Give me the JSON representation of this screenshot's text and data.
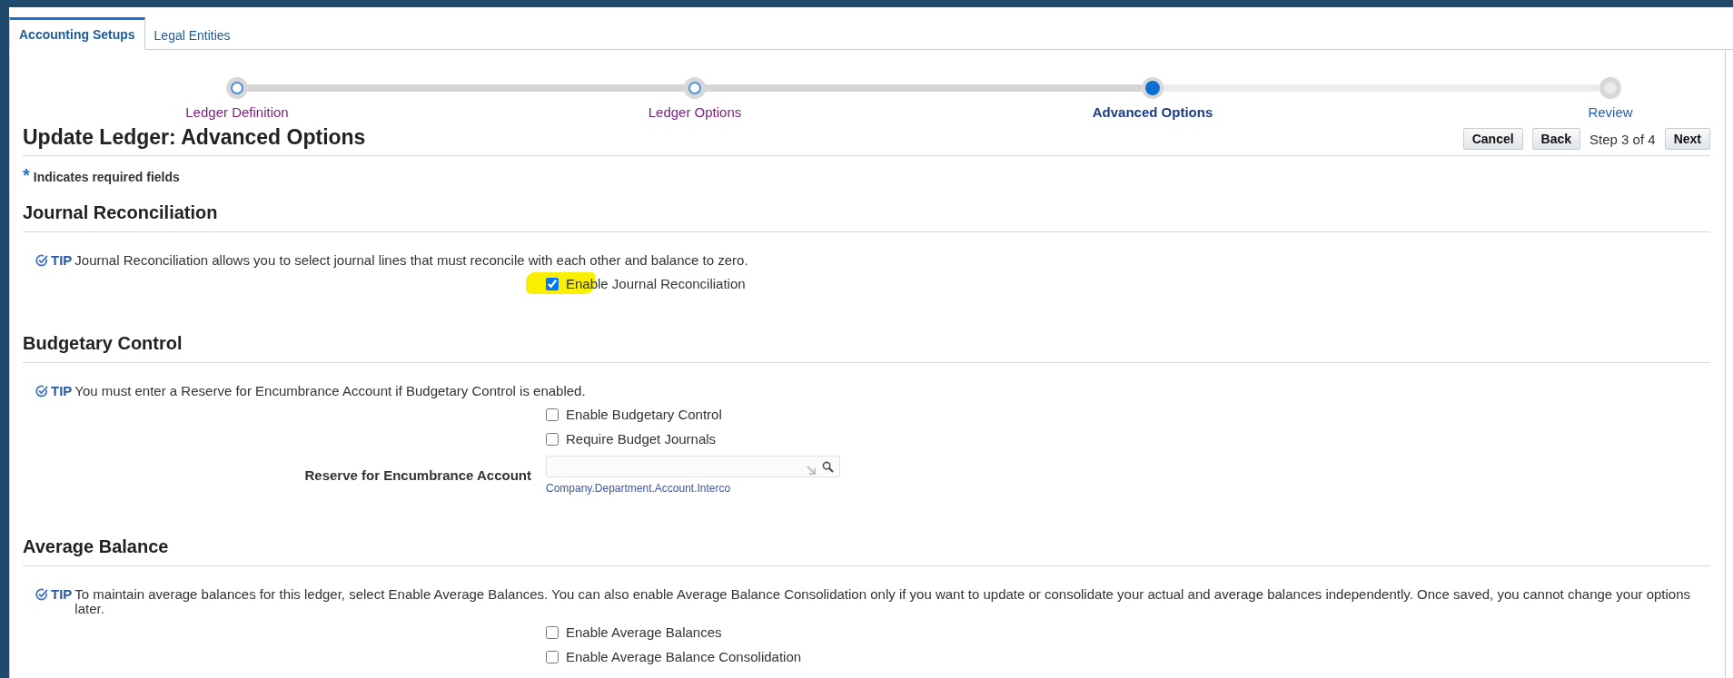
{
  "tabs": [
    {
      "label": "Accounting Setups",
      "selected": true
    },
    {
      "label": "Legal Entities",
      "selected": false
    }
  ],
  "train": [
    {
      "label": "Ledger Definition",
      "completed": true,
      "selected": false
    },
    {
      "label": "Ledger Options",
      "completed": true,
      "selected": false
    },
    {
      "label": "Advanced Options",
      "completed": false,
      "selected": true
    },
    {
      "label": "Review",
      "completed": false,
      "selected": false
    }
  ],
  "page_title": "Update Ledger: Advanced Options",
  "navigation": [
    {
      "kind": "button",
      "label": "Cancel"
    },
    {
      "kind": "button",
      "label": "Back"
    },
    {
      "kind": "text",
      "label": "Step 3 of 4"
    },
    {
      "kind": "button",
      "label": "Next"
    }
  ],
  "required_note": {
    "mark": "*",
    "text": "Indicates required fields"
  },
  "sections": [
    {
      "heading": "Journal Reconciliation",
      "tip": {
        "label": "TIP",
        "text": "Journal Reconciliation allows you to select journal lines that must reconcile with each other and balance to zero."
      },
      "fields": [
        {
          "kind": "checkbox",
          "label": "Enable Journal Reconciliation",
          "checked": true,
          "highlighted": true
        }
      ]
    },
    {
      "heading": "Budgetary Control",
      "tip": {
        "label": "TIP",
        "text": "You must enter a Reserve for Encumbrance Account if Budgetary Control is enabled."
      },
      "fields": [
        {
          "kind": "checkbox",
          "label": "Enable Budgetary Control",
          "checked": false,
          "highlighted": false
        },
        {
          "kind": "checkbox",
          "label": "Require Budget Journals",
          "checked": false,
          "highlighted": false
        },
        {
          "kind": "lov",
          "label": "Reserve for Encumbrance Account",
          "hint": "Company.Department.Account.Interco"
        }
      ]
    },
    {
      "heading": "Average Balance",
      "tip": {
        "label": "TIP",
        "text": "To maintain average balances for this ledger, select Enable Average Balances. You can also enable Average Balance Consolidation only if you want to update or consolidate your actual and average balances independently. Once saved, you cannot change your options later."
      },
      "fields": [
        {
          "kind": "checkbox",
          "label": "Enable Average Balances",
          "checked": false,
          "highlighted": false
        },
        {
          "kind": "checkbox",
          "label": "Enable Average Balance Consolidation",
          "checked": false,
          "highlighted": false
        }
      ]
    }
  ]
}
